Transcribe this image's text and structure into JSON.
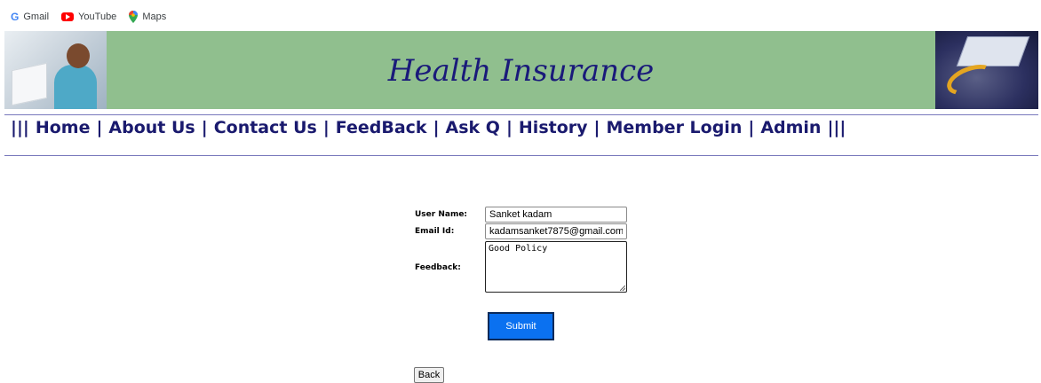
{
  "bookmarks": [
    {
      "label": "Gmail",
      "icon": "google-icon"
    },
    {
      "label": "YouTube",
      "icon": "youtube-icon"
    },
    {
      "label": "Maps",
      "icon": "maps-pin-icon"
    }
  ],
  "header": {
    "title": "Health Insurance",
    "background_color": "#90bf8e",
    "title_color": "#1a1a7a"
  },
  "nav": {
    "edge_left": "|||",
    "edge_right": "|||",
    "separator": "|",
    "items": [
      "Home",
      "About Us",
      "Contact Us",
      "FeedBack",
      "Ask Q",
      "History",
      "Member Login",
      "Admin"
    ],
    "color": "#1a1a6e"
  },
  "form": {
    "username_label": "User Name:",
    "username_value": "Sanket kadam",
    "email_label": "Email Id:",
    "email_value": "kadamsanket7875@gmail.com",
    "feedback_label": "Feedback:",
    "feedback_value": "Good Policy",
    "submit_label": "Submit",
    "back_label": "Back",
    "submit_color": "#0b71f0"
  }
}
